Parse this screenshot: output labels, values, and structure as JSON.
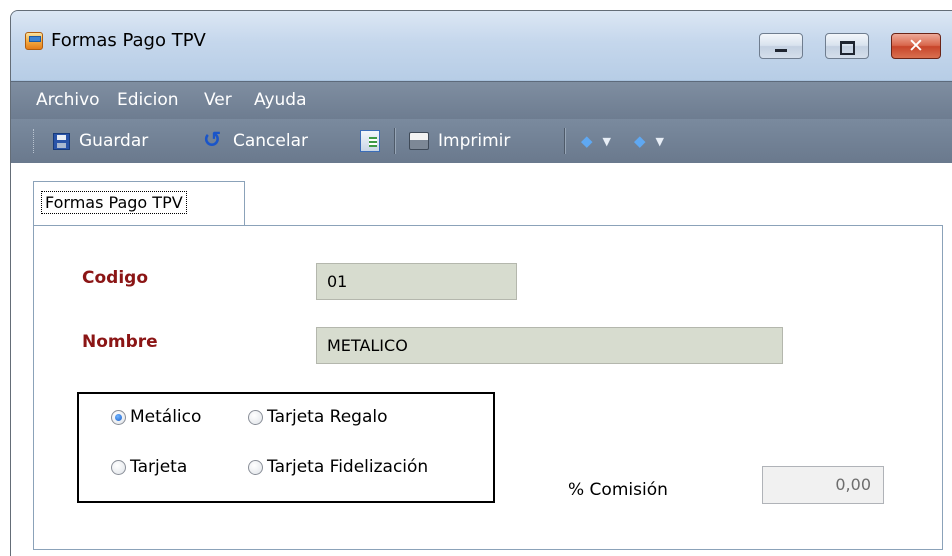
{
  "window": {
    "title": "Formas Pago TPV",
    "controls": {
      "minimize": "",
      "maximize": "",
      "close": "✕"
    }
  },
  "menu": [
    {
      "label": "Archivo"
    },
    {
      "label": "Edicion"
    },
    {
      "label": "Ver"
    },
    {
      "label": "Ayuda"
    }
  ],
  "toolbar": {
    "save_label": "Guardar",
    "cancel_label": "Cancelar",
    "print_label": "Imprimir",
    "icons": [
      "save-icon",
      "undo-icon",
      "report-icon",
      "print-icon",
      "nav-up-icon",
      "nav-down-icon"
    ]
  },
  "tab": {
    "label": "Formas Pago TPV"
  },
  "form": {
    "codigo_label": "Codigo",
    "codigo_value": "01",
    "nombre_label": "Nombre",
    "nombre_value": "METALICO",
    "radios": [
      {
        "label": "Metálico",
        "checked": true
      },
      {
        "label": "Tarjeta Regalo",
        "checked": false
      },
      {
        "label": "Tarjeta",
        "checked": false
      },
      {
        "label": "Tarjeta Fidelización",
        "checked": false
      }
    ],
    "comision_label": "% Comisión",
    "comision_value": "0,00"
  },
  "colors": {
    "label_red": "#8b1515",
    "menubar": "#6d7c90",
    "field_bg": "#d7dccf"
  }
}
